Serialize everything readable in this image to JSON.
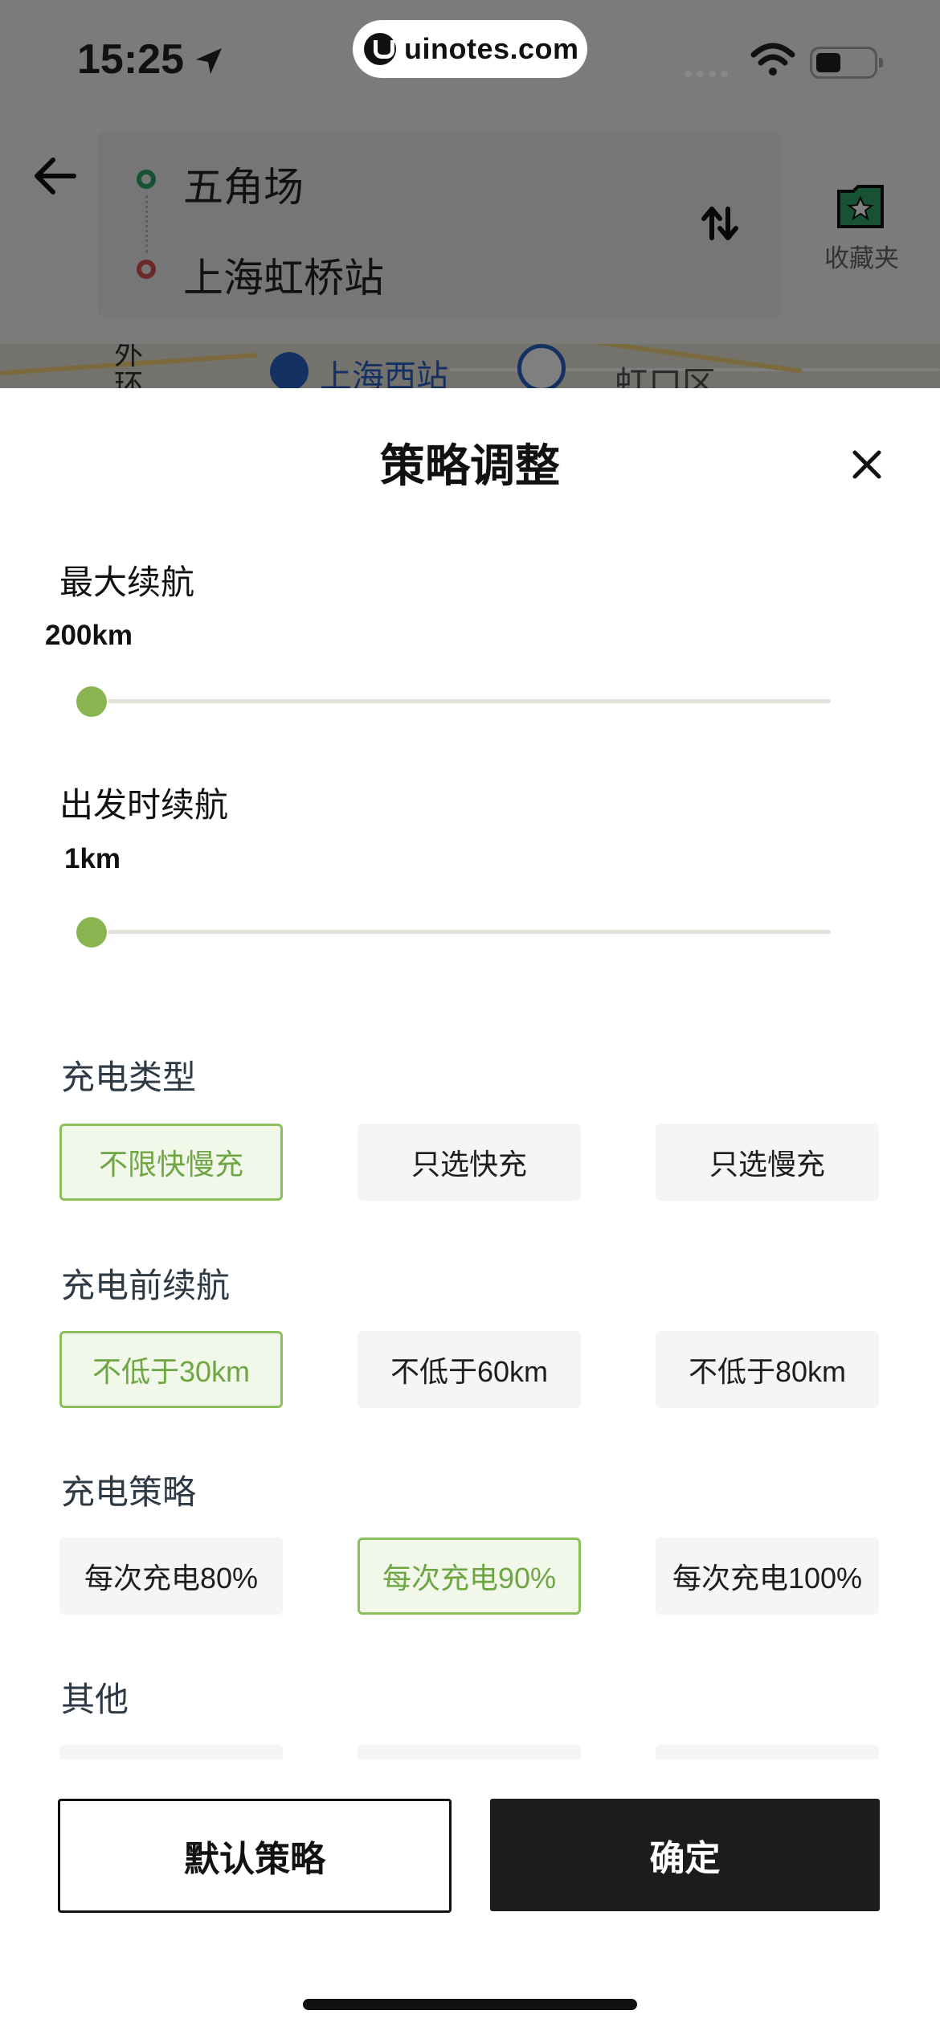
{
  "status_bar": {
    "time": "15:25",
    "site": "uinotes.com",
    "icons": [
      "location-arrow-icon",
      "signal-icon",
      "wifi-icon",
      "battery-icon"
    ]
  },
  "route": {
    "start": "五角场",
    "end": "上海虹桥站",
    "start_color": "#2ea56a",
    "end_color": "#d9534f",
    "favorites_label": "收藏夹"
  },
  "map": {
    "labels": [
      "外环",
      "上海西站",
      "虹口区"
    ]
  },
  "sheet": {
    "title": "策略调整",
    "sliders": [
      {
        "label": "最大续航",
        "value_text": "200km",
        "level": 0.0
      },
      {
        "label": "出发时续航",
        "value_text": "1km",
        "level": 0.0
      }
    ],
    "sections": [
      {
        "label": "充电类型",
        "options": [
          "不限快慢充",
          "只选快充",
          "只选慢充"
        ],
        "selected": 0
      },
      {
        "label": "充电前续航",
        "options": [
          "不低于30km",
          "不低于60km",
          "不低于80km"
        ],
        "selected": 0
      },
      {
        "label": "充电策略",
        "options": [
          "每次充电80%",
          "每次充电90%",
          "每次充电100%"
        ],
        "selected": 1
      },
      {
        "label": "其他",
        "options": []
      }
    ],
    "buttons": {
      "default": "默认策略",
      "confirm": "确定"
    },
    "accent_color": "#8cbf5e"
  }
}
